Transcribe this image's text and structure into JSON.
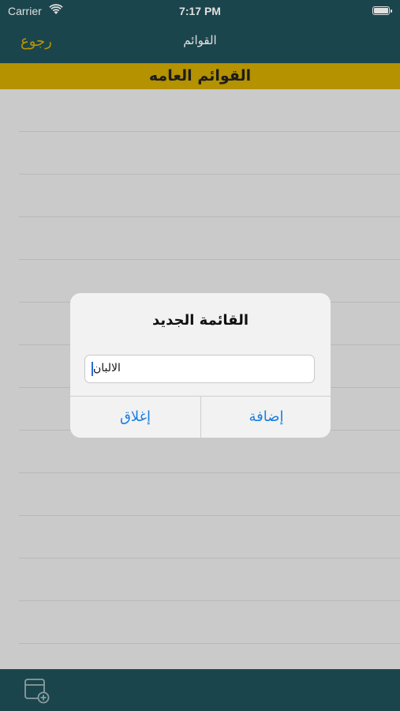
{
  "status_bar": {
    "carrier": "Carrier",
    "time": "7:17 PM"
  },
  "nav": {
    "back_label": "رجوع",
    "title": "القوائم"
  },
  "subheader": {
    "title": "القوائم العامه"
  },
  "dialog": {
    "title": "القائمة الجديد",
    "input_value": "الالبان",
    "close_label": "إغلاق",
    "add_label": "إضافة"
  },
  "toolbar": {
    "add_list_icon": "calendar-add-icon"
  },
  "colors": {
    "bar": "#1f4f57",
    "accent": "#cda700",
    "link": "#1b7ee0"
  }
}
